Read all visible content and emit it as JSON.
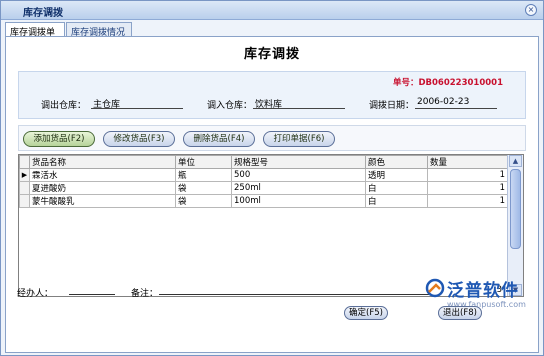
{
  "window": {
    "title": "库存调拨",
    "close_glyph": "×"
  },
  "tabs": [
    {
      "label": "库存调拨单"
    },
    {
      "label": "库存调拨情况"
    }
  ],
  "form": {
    "title": "库存调拨",
    "doc_no_label": "单号：",
    "doc_no": "DB060223010001",
    "out_warehouse_label": "调出仓库：",
    "out_warehouse": "主仓库",
    "in_warehouse_label": "调入仓库：",
    "in_warehouse": "饮料库",
    "date_label": "调拨日期：",
    "date": "2006-02-23"
  },
  "toolbar": {
    "add": "添加货品(F2)",
    "edit": "修改货品(F3)",
    "delete": "删除货品(F4)",
    "print": "打印单据(F6)"
  },
  "grid": {
    "columns": [
      "货品名称",
      "单位",
      "规格型号",
      "颜色",
      "数量"
    ],
    "rows": [
      {
        "name": "霖活水",
        "unit": "瓶",
        "spec": "500",
        "color": "透明",
        "qty": "1"
      },
      {
        "name": "夏进酸奶",
        "unit": "袋",
        "spec": "250ml",
        "color": "白",
        "qty": "1"
      },
      {
        "name": "蒙牛酸酸乳",
        "unit": "袋",
        "spec": "100ml",
        "color": "白",
        "qty": "1"
      }
    ],
    "row_count": "3",
    "current_row_marker": "▶",
    "scroll_up_glyph": "▲",
    "scroll_down_glyph": "▼"
  },
  "footer": {
    "handler_label": "经办人：",
    "remark_label": "备注：",
    "ok": "确定(F5)",
    "exit": "退出(F8)"
  },
  "logo": {
    "name": "泛普软件",
    "url": "www.fanpusoft.com"
  },
  "colors": {
    "doc_no": "#c8102e",
    "logo": "#1f58b3",
    "accent": "#8aa2c8"
  }
}
